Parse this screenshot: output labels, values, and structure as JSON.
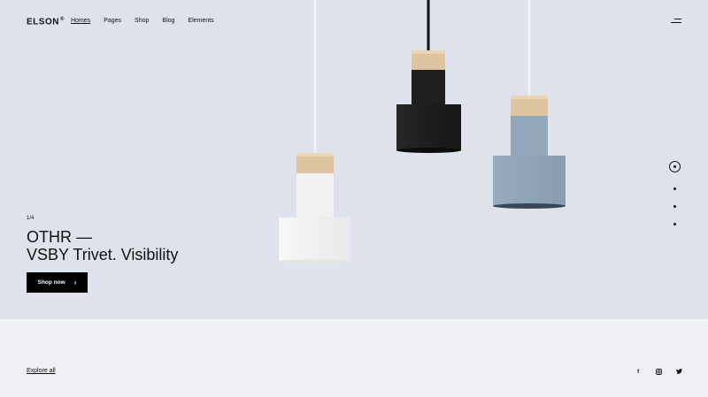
{
  "header": {
    "logo": "ELSON",
    "logo_mark": "®",
    "nav": [
      {
        "label": "Homes",
        "active": true
      },
      {
        "label": "Pages",
        "active": false
      },
      {
        "label": "Shop",
        "active": false
      },
      {
        "label": "Blog",
        "active": false
      },
      {
        "label": "Elements",
        "active": false
      }
    ],
    "menu_icon": "hamburger-icon"
  },
  "hero": {
    "slide_counter": "1/4",
    "title_line1": "OTHR —",
    "title_line2": "VSBY Trivet. Visibility",
    "cta_label": "Shop now",
    "cta_icon": "chevron-right-icon",
    "slider_dots": {
      "count": 4,
      "active_index": 0
    },
    "colors": {
      "background": "#dde2eb",
      "lamp_white": "#f4f4f4",
      "lamp_black": "#1c1c1c",
      "lamp_blue": "#8fa5b9",
      "wood": "#e2c9a6"
    }
  },
  "footer": {
    "explore_label": "Explore all",
    "social": [
      {
        "icon": "facebook-icon",
        "glyph": "f"
      },
      {
        "icon": "instagram-icon",
        "glyph": "◎"
      },
      {
        "icon": "twitter-icon",
        "glyph": "🐦"
      }
    ]
  }
}
